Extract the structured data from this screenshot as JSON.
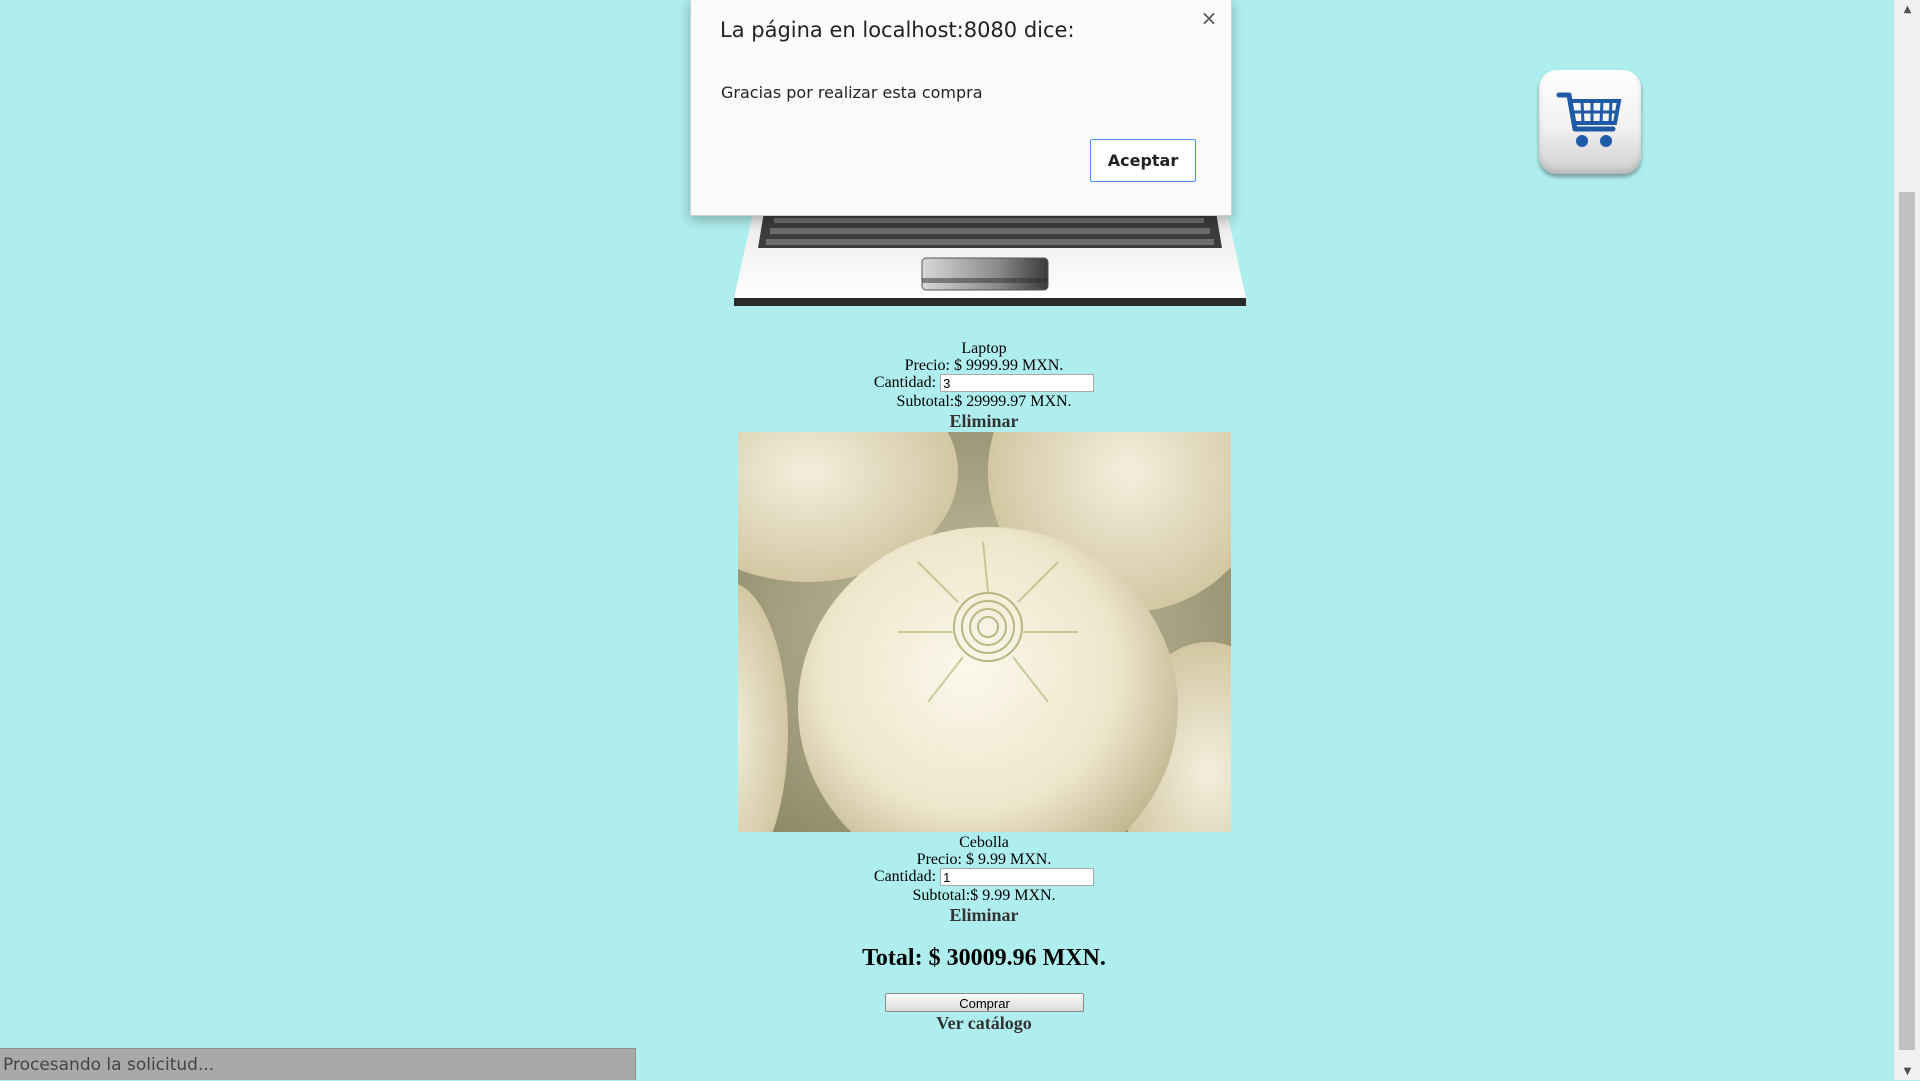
{
  "dialog": {
    "title": "La página en localhost:8080 dice:",
    "message": "Gracias por realizar esta compra",
    "ok_label": "Aceptar",
    "close_symbol": "×"
  },
  "cart": {
    "icon": "shopping-cart-icon"
  },
  "items": [
    {
      "name": "Laptop",
      "price_text": "Precio: $ 9999.99 MXN.",
      "qty_label": "Cantidad:",
      "qty_value": "3",
      "subtotal_text": "Subtotal:$ 29999.97 MXN.",
      "remove_label": "Eliminar"
    },
    {
      "name": "Cebolla",
      "price_text": "Precio: $ 9.99 MXN.",
      "qty_label": "Cantidad:",
      "qty_value": "1",
      "subtotal_text": "Subtotal:$ 9.99 MXN.",
      "remove_label": "Eliminar"
    }
  ],
  "total_text": "Total: $ 30009.96 MXN.",
  "buy_label": "Comprar",
  "catalog_label": "Ver catálogo",
  "status_text": "Procesando la solicitud..."
}
